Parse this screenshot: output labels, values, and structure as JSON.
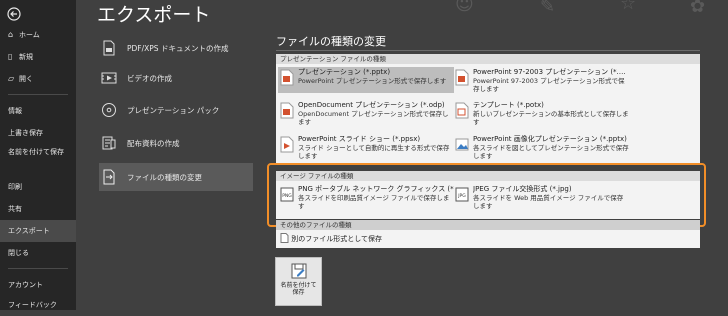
{
  "nav": {
    "items": [
      {
        "label": "ホーム",
        "icon": "home-icon"
      },
      {
        "label": "新規",
        "icon": "new-file-icon"
      },
      {
        "label": "開く",
        "icon": "open-folder-icon"
      },
      {
        "label": "情報"
      },
      {
        "label": "上書き保存"
      },
      {
        "label": "名前を付けて保存"
      },
      {
        "label": "印刷"
      },
      {
        "label": "共有"
      },
      {
        "label": "エクスポート",
        "active": true
      },
      {
        "label": "閉じる"
      },
      {
        "label": "アカウント"
      },
      {
        "label": "フィードバック"
      }
    ]
  },
  "page": {
    "title": "エクスポート"
  },
  "options": [
    {
      "label": "PDF/XPS ドキュメントの作成",
      "icon": "pdf-document-icon"
    },
    {
      "label": "ビデオの作成",
      "icon": "video-icon"
    },
    {
      "label": "プレゼンテーション パック",
      "icon": "cd-package-icon"
    },
    {
      "label": "配布資料の作成",
      "icon": "handout-icon"
    },
    {
      "label": "ファイルの種類の変更",
      "icon": "change-file-type-icon",
      "active": true
    }
  ],
  "file_types": {
    "title": "ファイルの種類の変更",
    "presentation_group": "プレゼンテーション ファイルの種類",
    "presentation_items": [
      {
        "title": "プレゼンテーション (*.pptx)",
        "desc": "PowerPoint プレゼンテーション形式で保存します",
        "icon": "pptx-icon",
        "selected": true
      },
      {
        "title": "PowerPoint 97-2003 プレゼンテーション (*.…",
        "desc": "PowerPoint 97-2003 プレゼンテーション形式で保存します",
        "icon": "ppt-icon"
      },
      {
        "title": "OpenDocument プレゼンテーション (*.odp)",
        "desc": "OpenDocument プレゼンテーション形式で保存します",
        "icon": "odp-icon"
      },
      {
        "title": "テンプレート (*.potx)",
        "desc": "新しいプレゼンテーションの基本形式として保存します",
        "icon": "potx-icon"
      },
      {
        "title": "PowerPoint スライド ショー (*.ppsx)",
        "desc": "スライド ショーとして自動的に再生する形式で保存します",
        "icon": "ppsx-icon"
      },
      {
        "title": "PowerPoint 画像化プレゼンテーション (*.pptx)",
        "desc": "各スライドを図としてプレゼンテーション形式で保存します",
        "icon": "picture-pptx-icon"
      }
    ],
    "image_group": "イメージ ファイルの種類",
    "image_items": [
      {
        "title": "PNG ポータブル ネットワーク グラフィックス (*.p…",
        "desc": "各スライドを印刷品質イメージ ファイルで保存します",
        "icon": "png-icon"
      },
      {
        "title": "JPEG ファイル交換形式 (*.jpg)",
        "desc": "各スライドを Web 用品質イメージ ファイルで保存します",
        "icon": "jpg-icon"
      }
    ],
    "other_group": "その他のファイルの種類",
    "other_items": [
      {
        "title": "別のファイル形式として保存",
        "icon": "other-format-icon"
      }
    ],
    "save_as_button": "名前を付けて保存"
  },
  "colors": {
    "highlight": "#f28e28",
    "nav_bg": "#262626",
    "main_bg": "#404040"
  }
}
